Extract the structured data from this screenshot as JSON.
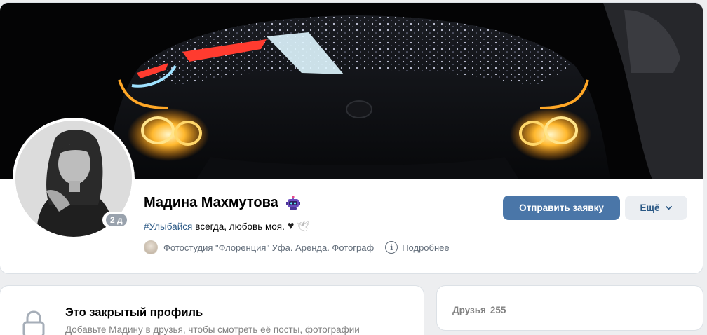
{
  "profile": {
    "name": "Мадина Махмутова",
    "online_badge": "2 д",
    "status_hashtag": "#Улыбайся",
    "status_text": "всегда, любовь моя.",
    "workplace": "Фотостудия \"Флоренция\" Уфа. Аренда. Фотограф",
    "more_info_label": "Подробнее",
    "icons": [
      "robot-emoji-icon",
      "black-heart-icon",
      "dove-icon",
      "info-icon",
      "chevron-down-icon",
      "lock-icon"
    ]
  },
  "actions": {
    "send_request": "Отправить заявку",
    "more": "Ещё"
  },
  "private_profile": {
    "title": "Это закрытый профиль",
    "subtitle": "Добавьте Мадину в друзья, чтобы смотреть её посты, фотографии"
  },
  "friends": {
    "label": "Друзья",
    "count": "255"
  },
  "colors": {
    "accent": "#4a76a8",
    "link": "#2a5885",
    "background": "#edeef0"
  }
}
